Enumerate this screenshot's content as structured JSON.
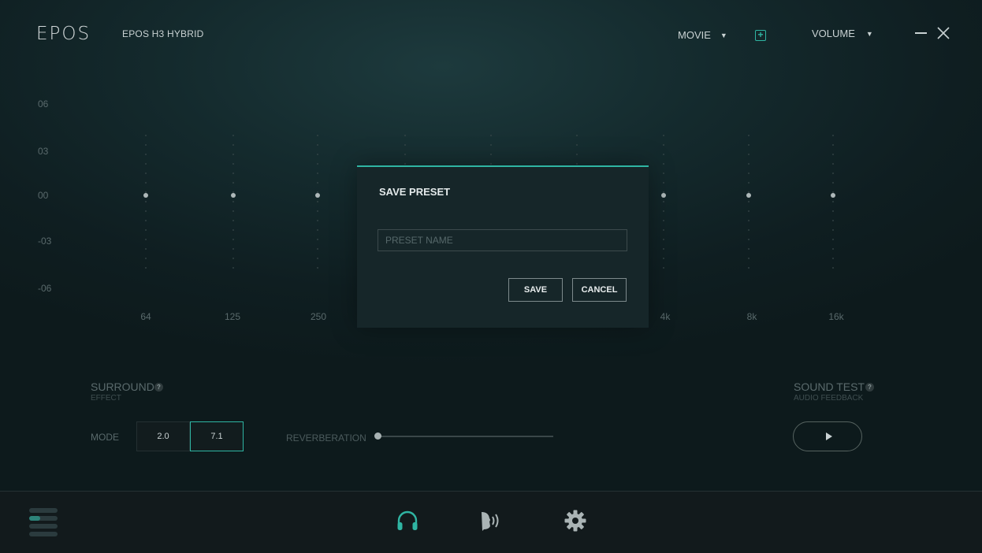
{
  "header": {
    "logo": "EPOS",
    "device_name": "EPOS H3 HYBRID",
    "preset_dropdown": "MOVIE",
    "volume_dropdown": "VOLUME"
  },
  "eq": {
    "y_labels": [
      "06",
      "03",
      "00",
      "-03",
      "-06"
    ],
    "x_labels": [
      "64",
      "125",
      "250",
      "4k",
      "8k",
      "16k"
    ],
    "gains_db": [
      0,
      0,
      0,
      0,
      0,
      0,
      0,
      0,
      0
    ],
    "accent_color": "#2fb5a3"
  },
  "modal": {
    "title": "SAVE PRESET",
    "input_placeholder": "PRESET NAME",
    "input_value": "",
    "save_label": "SAVE",
    "cancel_label": "CANCEL"
  },
  "surround": {
    "title": "SURROUND",
    "subtitle": "EFFECT",
    "mode_label": "MODE",
    "modes": [
      "2.0",
      "7.1"
    ],
    "selected_mode": "7.1",
    "reverb_label": "REVERBERATION",
    "reverb_level": 0
  },
  "sound_test": {
    "title": "SOUND TEST",
    "subtitle": "AUDIO FEEDBACK"
  },
  "bottom_nav": {
    "items": [
      "menu-icon",
      "headphones-icon",
      "voice-icon",
      "gear-icon"
    ],
    "active": "headphones-icon"
  }
}
